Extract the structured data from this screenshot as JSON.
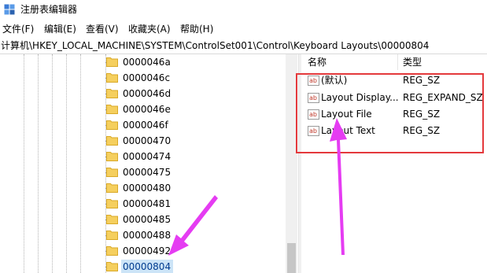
{
  "window": {
    "title": "注册表编辑器"
  },
  "menu": {
    "items": [
      "文件(F)",
      "编辑(E)",
      "查看(V)",
      "收藏夹(A)",
      "帮助(H)"
    ]
  },
  "address": {
    "path": "计算机\\HKEY_LOCAL_MACHINE\\SYSTEM\\ControlSet001\\Control\\Keyboard Layouts\\00000804"
  },
  "tree": {
    "items": [
      "0000046a",
      "0000046c",
      "0000046d",
      "0000046e",
      "0000046f",
      "00000470",
      "00000474",
      "00000475",
      "00000480",
      "00000481",
      "00000485",
      "00000488",
      "00000492",
      "00000804"
    ],
    "selected": "00000804"
  },
  "list": {
    "headers": {
      "name": "名称",
      "type": "类型"
    },
    "rows": [
      {
        "name": "(默认)",
        "type": "REG_SZ"
      },
      {
        "name": "Layout Display...",
        "type": "REG_EXPAND_SZ"
      },
      {
        "name": "Layout File",
        "type": "REG_SZ"
      },
      {
        "name": "Layout Text",
        "type": "REG_SZ"
      }
    ]
  },
  "icons": {
    "app": "registry-editor-icon",
    "folder": "folder-icon",
    "value": "string-value-icon"
  },
  "colors": {
    "folder": "#f5cf5e",
    "selection": "#cce4f7",
    "highlight_box": "#e4393c",
    "annotation_arrow": "#e53cf2"
  }
}
